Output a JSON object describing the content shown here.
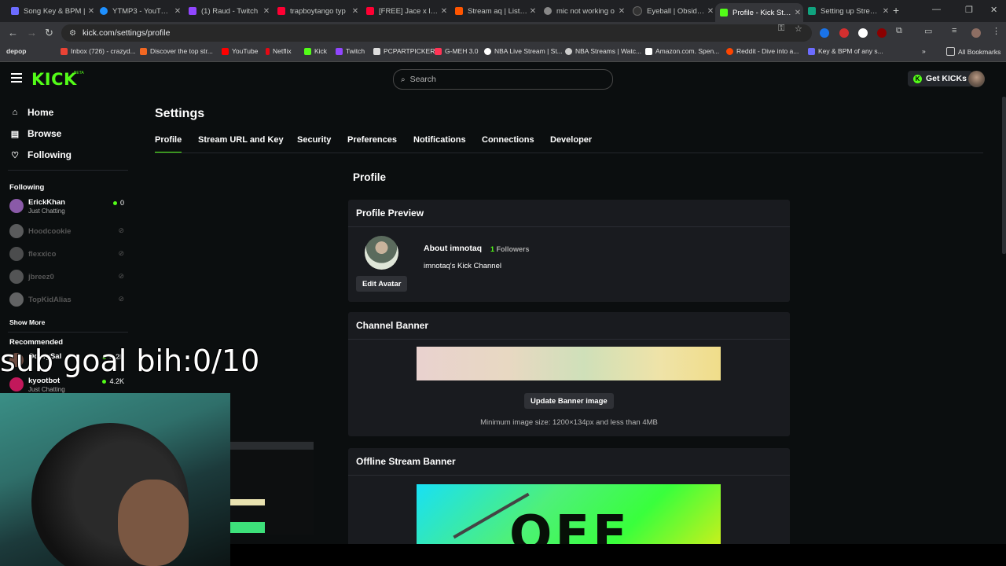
{
  "browser": {
    "tabs": [
      {
        "title": "Song Key & BPM |",
        "color": "#6c6cff"
      },
      {
        "title": "YTMP3 - YouTube",
        "color": "#1e90ff"
      },
      {
        "title": "(1) Raud - Twitch",
        "color": "#9146ff"
      },
      {
        "title": "trapboytango typ",
        "color": "#ff0033"
      },
      {
        "title": "[FREE] Jace x layze",
        "color": "#ff0033"
      },
      {
        "title": "Stream aq | Listen",
        "color": "#ff5500"
      },
      {
        "title": "mic not working o",
        "color": "#888888"
      },
      {
        "title": "Eyeball | Obsidian",
        "color": "#333333"
      },
      {
        "title": "Profile - Kick Strea",
        "color": "#53fc18"
      },
      {
        "title": "Setting up Stream",
        "color": "#10a37f"
      }
    ],
    "url": "kick.com/settings/profile",
    "bookmarks": [
      {
        "label": "depop",
        "color": "#000000"
      },
      {
        "label": "Inbox (726) - crazyd...",
        "color": "#ea4335"
      },
      {
        "label": "Discover the top str...",
        "color": "#f26722"
      },
      {
        "label": "YouTube",
        "color": "#ff0000"
      },
      {
        "label": "Netflix",
        "color": "#e50914"
      },
      {
        "label": "Kick",
        "color": "#53fc18"
      },
      {
        "label": "Twitch",
        "color": "#9146ff"
      },
      {
        "label": "PCPARTPICKER",
        "color": "#eeeeee"
      },
      {
        "label": "G-MEH 3.0",
        "color": "#ff3355"
      },
      {
        "label": "NBA Live Stream | St...",
        "color": "#ffffff"
      },
      {
        "label": "NBA Streams | Watc...",
        "color": "#cccccc"
      },
      {
        "label": "Amazon.com. Spen...",
        "color": "#ffffff"
      },
      {
        "label": "Reddit - Dive into a...",
        "color": "#ff4500"
      },
      {
        "label": "Key & BPM of any s...",
        "color": "#6c6cff"
      }
    ],
    "all_bookmarks": "All Bookmarks"
  },
  "header": {
    "logo": "KICK",
    "logo_badge": "BETA",
    "search_placeholder": "Search",
    "get_kicks": "Get KICKs"
  },
  "sidebar": {
    "nav": [
      "Home",
      "Browse",
      "Following"
    ],
    "following_title": "Following",
    "following": [
      {
        "name": "ErickKhan",
        "category": "Just Chatting",
        "viewers": "0",
        "live": true
      },
      {
        "name": "Hoodcookie",
        "live": false
      },
      {
        "name": "flexxico",
        "live": false
      },
      {
        "name": "jbreez0",
        "live": false
      },
      {
        "name": "TopKidAlias",
        "live": false
      }
    ],
    "show_more": "Show More",
    "recommended_title": "Recommended",
    "recommended": [
      {
        "name": "OdbrySal",
        "viewers": "4.2K"
      },
      {
        "name": "kyootbot",
        "category": "Just Chatting",
        "viewers": "4.2K"
      }
    ]
  },
  "settings": {
    "title": "Settings",
    "tabs": [
      "Profile",
      "Stream URL and Key",
      "Security",
      "Preferences",
      "Notifications",
      "Connections",
      "Developer"
    ],
    "section_title": "Profile",
    "profile_preview": {
      "heading": "Profile Preview",
      "about": "About imnotaq",
      "followers_count": "1",
      "followers_label": "Followers",
      "bio": "imnotaq's Kick Channel",
      "edit_avatar": "Edit Avatar"
    },
    "channel_banner": {
      "heading": "Channel Banner",
      "button": "Update Banner image",
      "note": "Minimum image size: 1200×134px and less than 4MB"
    },
    "offline_banner": {
      "heading": "Offline Stream Banner",
      "image_text": "OFF"
    }
  },
  "overlay": {
    "sub_goal": "sub goal bih:0/10"
  },
  "colors": {
    "accent": "#53fc18",
    "background": "#0b0e0f",
    "card": "#191b1f"
  }
}
